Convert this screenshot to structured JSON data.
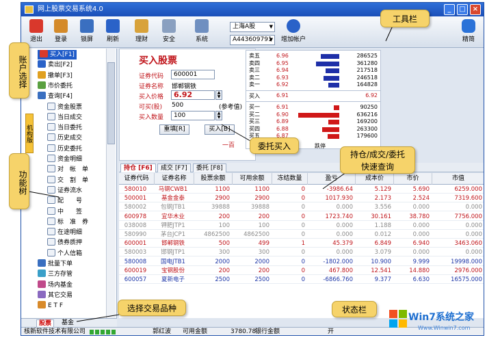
{
  "window": {
    "title": "网上股票交易系统4.0"
  },
  "toolbar": {
    "buttons": [
      {
        "label": "退出",
        "icon": "exit-icon",
        "color": "#d9382c"
      },
      {
        "label": "登录",
        "icon": "login-icon",
        "color": "#d48a2a"
      },
      {
        "label": "锁屏",
        "icon": "lock-icon",
        "color": "#3a6fc0"
      },
      {
        "label": "刷新",
        "icon": "refresh-icon",
        "color": "#2a62c8"
      },
      {
        "label": "理财",
        "icon": "finance-icon",
        "color": "#d8a23a"
      },
      {
        "label": "安全",
        "icon": "security-icon",
        "color": "#8aa0c0"
      },
      {
        "label": "系统",
        "icon": "system-icon",
        "color": "#6f8fc0"
      }
    ],
    "market_select": "上海A股",
    "account_select": "A443609791",
    "add_account_label": "增加帐户",
    "simple_label": "精简"
  },
  "tree": {
    "items": [
      {
        "label": "买入[F1]",
        "level": 0,
        "icon": "buy-icon",
        "selected": true
      },
      {
        "label": "卖出[F2]",
        "level": 0,
        "icon": "sell-icon"
      },
      {
        "label": "撤单[F3]",
        "level": 0,
        "icon": "cancel-order-icon"
      },
      {
        "label": "市价委托",
        "level": 0,
        "icon": "market-order-icon"
      },
      {
        "label": "查询[F4]",
        "level": 0,
        "icon": "query-icon"
      },
      {
        "label": "资金股票",
        "level": 1,
        "icon": "document-icon"
      },
      {
        "label": "当日成交",
        "level": 1,
        "icon": "document-icon"
      },
      {
        "label": "当日委托",
        "level": 1,
        "icon": "document-icon"
      },
      {
        "label": "历史成交",
        "level": 1,
        "icon": "document-icon"
      },
      {
        "label": "历史委托",
        "level": 1,
        "icon": "document-icon"
      },
      {
        "label": "资金明细",
        "level": 1,
        "icon": "document-icon"
      },
      {
        "label": "对　帐　单",
        "level": 1,
        "icon": "document-icon"
      },
      {
        "label": "交　割　单",
        "level": 1,
        "icon": "document-icon"
      },
      {
        "label": "证券流水",
        "level": 1,
        "icon": "document-icon"
      },
      {
        "label": "配　　号",
        "level": 1,
        "icon": "document-icon"
      },
      {
        "label": "中　　签",
        "level": 1,
        "icon": "document-icon"
      },
      {
        "label": "标　准　券",
        "level": 1,
        "icon": "document-icon"
      },
      {
        "label": "在途明细",
        "level": 1,
        "icon": "document-icon"
      },
      {
        "label": "债券质押",
        "level": 1,
        "icon": "document-icon"
      },
      {
        "label": "个人信箱",
        "level": 1,
        "icon": "document-icon"
      },
      {
        "label": "批量下单",
        "level": 0,
        "icon": "batch-order-icon"
      },
      {
        "label": "三方存管",
        "level": 0,
        "icon": "custody-icon"
      },
      {
        "label": "场内基金",
        "level": 0,
        "icon": "fund-icon"
      },
      {
        "label": "其它交易",
        "level": 0,
        "icon": "other-trade-icon"
      },
      {
        "label": "E T F",
        "level": 0,
        "icon": "etf-icon"
      }
    ],
    "vertical_tab": "机构版",
    "bottom_tabs": [
      "股票",
      "基金"
    ]
  },
  "buy_form": {
    "title": "买入股票",
    "code_label": "证券代码",
    "code_value": "600001",
    "name_label": "证券名称",
    "name_value": "邯郸钢铁",
    "price_label": "买入价格",
    "price_value": "6.92",
    "available_label": "可买(股)",
    "available_value": "500",
    "ref_label": "(参考值)",
    "qty_label": "买入数量",
    "qty_value": "100",
    "reset_label": "重填[R]",
    "buy_label": "买入[B]",
    "hint": "一百"
  },
  "quote": {
    "sell": [
      {
        "name": "卖五",
        "price": "6.96",
        "vol": "286525",
        "frac": 0.45
      },
      {
        "name": "卖四",
        "price": "6.95",
        "vol": "361280",
        "frac": 0.57
      },
      {
        "name": "卖三",
        "price": "6.94",
        "vol": "217518",
        "frac": 0.34
      },
      {
        "name": "卖二",
        "price": "6.93",
        "vol": "246518",
        "frac": 0.39
      },
      {
        "name": "卖一",
        "price": "6.92",
        "vol": "164828",
        "frac": 0.26
      }
    ],
    "buy_label": "买入",
    "buy_price": "6.91",
    "buy_price2": "6.92",
    "buy": [
      {
        "name": "买一",
        "price": "6.91",
        "vol": "90250",
        "frac": 0.14
      },
      {
        "name": "买二",
        "price": "6.90",
        "vol": "636216",
        "frac": 1.0
      },
      {
        "name": "买三",
        "price": "6.89",
        "vol": "169200",
        "frac": 0.27
      },
      {
        "name": "买四",
        "price": "6.88",
        "vol": "263300",
        "frac": 0.41
      },
      {
        "name": "买五",
        "price": "6.87",
        "vol": "179600",
        "frac": 0.28
      }
    ],
    "limit_down": "跌停"
  },
  "grid_tabs": [
    "持仓 [F6]",
    "成交 [F7]",
    "委托 [F8]"
  ],
  "grid": {
    "columns": [
      "证券代码",
      "证券名称",
      "股票余额",
      "可用余额",
      "冻结数量",
      "盈亏",
      "成本价",
      "市价",
      "市值"
    ],
    "rows": [
      {
        "tone": "red",
        "cells": [
          "580010",
          "马钢CWB1",
          "1100",
          "1100",
          "0",
          "-3986.64",
          "5.129",
          "5.690",
          "6259.000"
        ]
      },
      {
        "tone": "red",
        "cells": [
          "500001",
          "基金金泰",
          "2900",
          "2900",
          "0",
          "1017.930",
          "2.173",
          "2.524",
          "7319.600"
        ]
      },
      {
        "tone": "gray",
        "cells": [
          "580002",
          "包钢JTB1",
          "39888",
          "39888",
          "0",
          "0.000",
          "3.556",
          "0.000",
          "0.000"
        ]
      },
      {
        "tone": "red",
        "cells": [
          "600978",
          "宜华木业",
          "200",
          "200",
          "0",
          "1723.740",
          "30.161",
          "38.780",
          "7756.000"
        ]
      },
      {
        "tone": "gray",
        "cells": [
          "038008",
          "钾肥JTP1",
          "100",
          "100",
          "0",
          "0.000",
          "1.188",
          "0.000",
          "0.000"
        ]
      },
      {
        "tone": "gray",
        "cells": [
          "580990",
          "茅台JCP1",
          "4862500",
          "4862500",
          "0",
          "0.000",
          "0.012",
          "0.000",
          "0.000"
        ]
      },
      {
        "tone": "red",
        "cells": [
          "600001",
          "邯郸钢铁",
          "500",
          "499",
          "1",
          "45.379",
          "6.849",
          "6.940",
          "3463.060"
        ]
      },
      {
        "tone": "gray",
        "cells": [
          "580003",
          "邯钢JTP1",
          "300",
          "300",
          "0",
          "0.000",
          "3.079",
          "0.000",
          "0.000"
        ]
      },
      {
        "tone": "blue",
        "cells": [
          "580008",
          "国电JTB1",
          "2000",
          "2000",
          "0",
          "-1802.000",
          "10.900",
          "9.999",
          "19998.000"
        ]
      },
      {
        "tone": "red",
        "cells": [
          "600019",
          "宝钢股份",
          "200",
          "200",
          "0",
          "467.800",
          "12.541",
          "14.880",
          "2976.000"
        ]
      },
      {
        "tone": "blue",
        "cells": [
          "600057",
          "夏新电子",
          "2500",
          "2500",
          "0",
          "-6866.760",
          "9.377",
          "6.630",
          "16575.000"
        ]
      }
    ]
  },
  "status": {
    "company": "核新软件技术有限公司",
    "user": "郭红波",
    "available_label": "可用金额",
    "available_value": "3780.78",
    "bank_label": "银行金额",
    "open_label": "开"
  },
  "callouts": {
    "toolbar": "工具栏",
    "account": "账户选择",
    "function_tree": "功能树",
    "entrust_buy": "委托买入",
    "quick_query": "持仓/成交/委托快速查询",
    "select_variety": "选择交易品种",
    "status_bar": "状态栏"
  },
  "watermark": {
    "brand": "Win7系统之家",
    "url": "Www.Winwin7.com"
  },
  "colors": {
    "title_blue": "#1b4fb8",
    "callout_yellow": "#f6d36a",
    "price_red": "#c0141a",
    "sell_bar_blue": "#1e2fa8",
    "buy_bar_red": "#d01818"
  }
}
